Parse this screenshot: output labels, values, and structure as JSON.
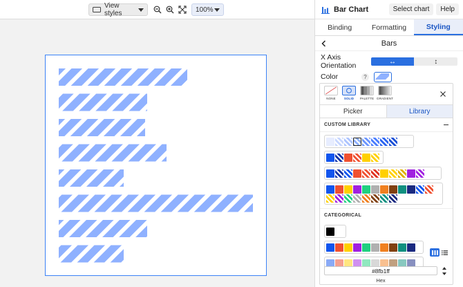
{
  "toolbar": {
    "view_styles_label": "View styles",
    "zoom_value": "100%"
  },
  "canvas": {
    "bar_values": [
      186,
      128,
      125,
      156,
      94,
      281,
      128,
      94
    ],
    "bar_color": "#8fb1ff",
    "stripe_color": "#ffffff"
  },
  "panel": {
    "title": "Bar Chart",
    "select_chart_label": "Select chart",
    "help_label": "Help",
    "tabs": [
      {
        "label": "Binding",
        "active": false
      },
      {
        "label": "Formatting",
        "active": false
      },
      {
        "label": "Styling",
        "active": true
      }
    ],
    "section_title": "Bars",
    "x_axis_label": "X Axis Orientation",
    "orientation_horizontal": "↔",
    "orientation_vertical": "↕",
    "color_label": "Color",
    "help_mark": "?",
    "accent_color": "#2a6fe0"
  },
  "picker": {
    "fill_types": [
      {
        "label": "NONE",
        "active": false
      },
      {
        "label": "SOLID",
        "active": true
      },
      {
        "label": "PALETTE",
        "active": false
      },
      {
        "label": "GRADIENT",
        "active": false
      }
    ],
    "sub_tabs": [
      {
        "label": "Picker",
        "active": false
      },
      {
        "label": "Library",
        "active": true
      }
    ],
    "custom_library_label": "CUSTOM LIBRARY",
    "categorical_label": "CATEGORICAL",
    "hex_value": "#8fb1ff",
    "hex_label": "Hex"
  }
}
